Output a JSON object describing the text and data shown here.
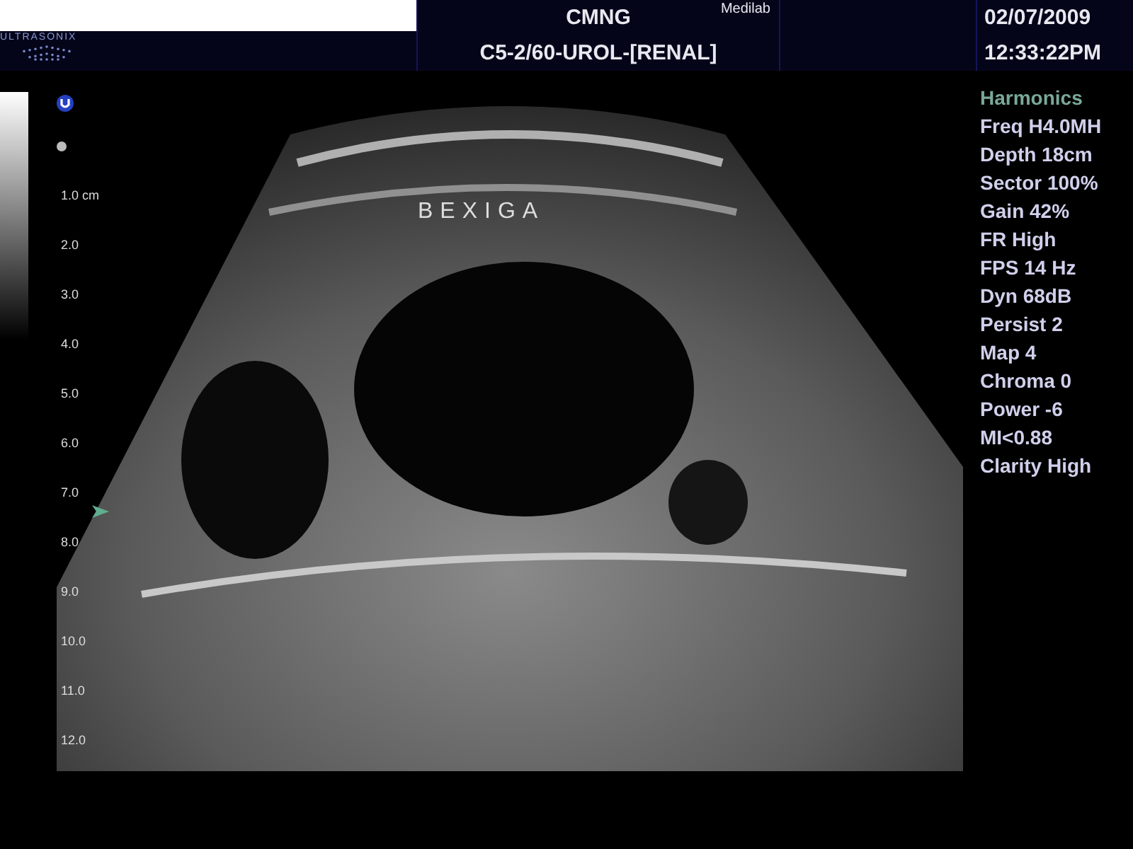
{
  "header": {
    "logo": "ULTRASONIX",
    "site": "CMNG",
    "operator": "Medilab",
    "preset": "C5-2/60-UROL-[RENAL]",
    "date": "02/07/2009",
    "time": "12:33:22PM"
  },
  "image": {
    "label": "BEXIGA"
  },
  "depth_scale": [
    "1.0 cm",
    "2.0",
    "3.0",
    "4.0",
    "5.0",
    "6.0",
    "7.0",
    "8.0",
    "9.0",
    "10.0",
    "11.0",
    "12.0"
  ],
  "parameters": [
    {
      "kind": "mode",
      "text": "Harmonics"
    },
    {
      "kind": "param",
      "text": "Freq H4.0MH"
    },
    {
      "kind": "param",
      "text": "Depth 18cm"
    },
    {
      "kind": "param",
      "text": "Sector 100%"
    },
    {
      "kind": "param",
      "text": "Gain 42%"
    },
    {
      "kind": "param",
      "text": "FR High"
    },
    {
      "kind": "param",
      "text": "FPS 14 Hz"
    },
    {
      "kind": "param",
      "text": "Dyn 68dB"
    },
    {
      "kind": "param",
      "text": "Persist 2"
    },
    {
      "kind": "param",
      "text": "Map 4"
    },
    {
      "kind": "param",
      "text": "Chroma 0"
    },
    {
      "kind": "param",
      "text": "Power -6"
    },
    {
      "kind": "param",
      "text": "MI<0.88"
    },
    {
      "kind": "param",
      "text": "Clarity High"
    }
  ]
}
